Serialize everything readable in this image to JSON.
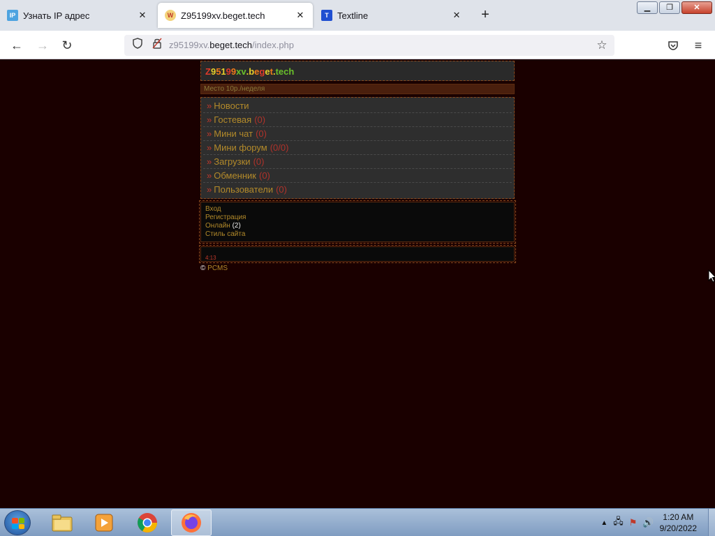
{
  "browser": {
    "tabs": [
      {
        "title": "Узнать IP адрес",
        "favicon": "IP",
        "favicon_color": "#4da3e0",
        "active": false
      },
      {
        "title": "Z95199xv.beget.tech",
        "favicon": "W",
        "favicon_color": "#c0392b",
        "active": true
      },
      {
        "title": "Textline",
        "favicon": "T",
        "favicon_color": "#1f4fd1",
        "active": false
      }
    ],
    "new_tab": "+",
    "url": {
      "prefix": "z95199xv.",
      "domain": "beget.tech",
      "path": "/index.php"
    },
    "icons": {
      "back": "back-arrow-icon",
      "forward": "forward-arrow-icon",
      "reload": "reload-icon",
      "shield": "tracking-protection-icon",
      "lock": "insecure-lock-icon",
      "bookmark": "bookmark-star-icon",
      "pocket": "pocket-icon",
      "menu": "hamburger-menu-icon"
    }
  },
  "site": {
    "logo_letters": [
      {
        "ch": "Z",
        "color": "#e03a2a"
      },
      {
        "ch": "9",
        "color": "#e8d02a"
      },
      {
        "ch": "5",
        "color": "#f07a1a"
      },
      {
        "ch": "1",
        "color": "#e8d02a"
      },
      {
        "ch": "9",
        "color": "#e03a2a"
      },
      {
        "ch": "9",
        "color": "#f07a1a"
      },
      {
        "ch": "x",
        "color": "#6ac02a"
      },
      {
        "ch": "v",
        "color": "#6ac02a"
      },
      {
        "ch": ".",
        "color": "#e8d02a"
      },
      {
        "ch": "b",
        "color": "#e8d02a"
      },
      {
        "ch": "e",
        "color": "#f07a1a"
      },
      {
        "ch": "g",
        "color": "#e03a2a"
      },
      {
        "ch": "e",
        "color": "#e8d02a"
      },
      {
        "ch": "t",
        "color": "#f07a1a"
      },
      {
        "ch": ".",
        "color": "#e8d02a"
      },
      {
        "ch": "t",
        "color": "#6ac02a"
      },
      {
        "ch": "e",
        "color": "#6ac02a"
      },
      {
        "ch": "c",
        "color": "#6ac02a"
      },
      {
        "ch": "h",
        "color": "#6ac02a"
      }
    ],
    "slogan": "Место 10р./неделя",
    "menu": [
      {
        "raquo": "»",
        "label": "Новости",
        "count": ""
      },
      {
        "raquo": "»",
        "label": "Гостевая",
        "count": "(0)"
      },
      {
        "raquo": "»",
        "label": "Мини чат",
        "count": "(0)"
      },
      {
        "raquo": "»",
        "label": "Мини форум",
        "count": "(0/0)"
      },
      {
        "raquo": "»",
        "label": "Загрузки",
        "count": "(0)"
      },
      {
        "raquo": "»",
        "label": "Обменник",
        "count": "(0)"
      },
      {
        "raquo": "»",
        "label": "Пользователи",
        "count": "(0)"
      }
    ],
    "user_links": {
      "login": "Вход",
      "register": "Регистрация",
      "online_label": "Онлайн",
      "online_count": "(2)",
      "style": "Стиль сайта"
    },
    "time": "4:13",
    "copyright_symbol": "©",
    "copyright_link": "PCMS"
  },
  "taskbar": {
    "apps": [
      {
        "name": "explorer",
        "icon": "folder-icon"
      },
      {
        "name": "media-player",
        "icon": "media-player-icon"
      },
      {
        "name": "chrome",
        "icon": "chrome-icon"
      },
      {
        "name": "firefox",
        "icon": "firefox-icon",
        "active": true
      }
    ],
    "clock_time": "1:20 AM",
    "clock_date": "9/20/2022"
  }
}
